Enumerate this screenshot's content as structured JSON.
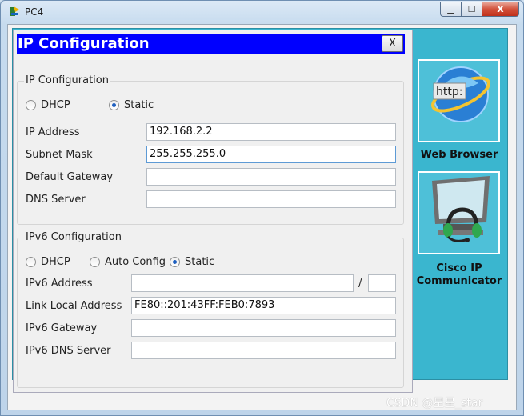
{
  "window": {
    "title": "PC4",
    "min_symbol": "▁",
    "max_symbol": "☐",
    "close_symbol": "x"
  },
  "dialog": {
    "title": "IP Configuration",
    "close_label": "X"
  },
  "ipv4": {
    "legend": "IP Configuration",
    "dhcp_label": "DHCP",
    "static_label": "Static",
    "selected_mode": "Static",
    "fields": {
      "ip_address": {
        "label": "IP Address",
        "value": "192.168.2.2"
      },
      "subnet_mask": {
        "label": "Subnet Mask",
        "value": "255.255.255.0"
      },
      "default_gateway": {
        "label": "Default Gateway",
        "value": ""
      },
      "dns_server": {
        "label": "DNS Server",
        "value": ""
      }
    }
  },
  "ipv6": {
    "legend": "IPv6 Configuration",
    "dhcp_label": "DHCP",
    "auto_label": "Auto Config",
    "static_label": "Static",
    "selected_mode": "Static",
    "prefix_separator": "/",
    "fields": {
      "ipv6_address": {
        "label": "IPv6 Address",
        "value": "",
        "prefix": ""
      },
      "link_local": {
        "label": "Link Local Address",
        "value": "FE80::201:43FF:FEB0:7893"
      },
      "ipv6_gateway": {
        "label": "IPv6 Gateway",
        "value": ""
      },
      "ipv6_dns": {
        "label": "IPv6 DNS Server",
        "value": ""
      }
    }
  },
  "apps": [
    {
      "name": "Web Browser",
      "icon": "web-browser-icon",
      "icon_text": "http:"
    },
    {
      "name": "Cisco IP Communicator",
      "icon": "ip-communicator-icon"
    }
  ],
  "watermark": "CSDN @星星_star",
  "colors": {
    "dialog_title_bg": "#0000ff",
    "desktop_bg": "#3ab6cf"
  }
}
